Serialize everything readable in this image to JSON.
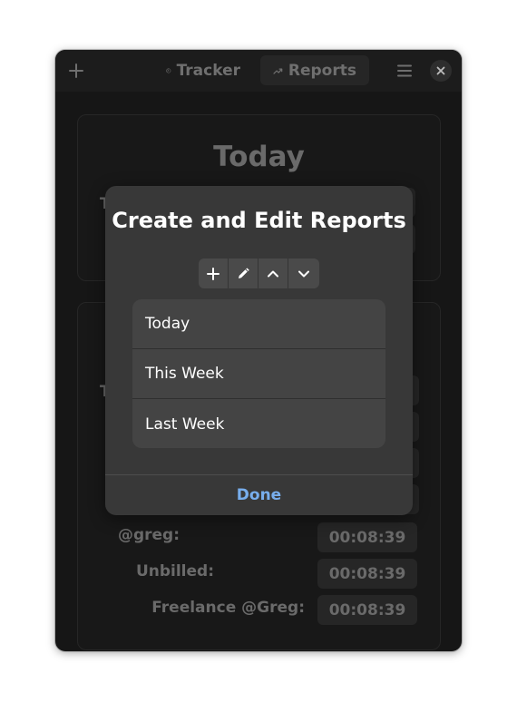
{
  "header": {
    "tabs": [
      {
        "label": "Tracker",
        "icon": "clock-icon"
      },
      {
        "label": "Reports",
        "icon": "trend-up-icon"
      }
    ],
    "active_tab": "Reports"
  },
  "background": {
    "card1_title": "Today",
    "fragment_t1": "T",
    "fragment_t2": "T",
    "rows": [
      {
        "label": "@greg:",
        "time": "00:08:39"
      },
      {
        "label": "Unbilled:",
        "time": "00:08:39"
      },
      {
        "label": "Freelance @Greg:",
        "time": "00:08:39"
      }
    ]
  },
  "dialog": {
    "title": "Create and Edit Reports",
    "toolbar_icons": [
      "plus-icon",
      "pencil-icon",
      "chevron-up-icon",
      "chevron-down-icon"
    ],
    "reports": [
      "Today",
      "This Week",
      "Last Week"
    ],
    "done_label": "Done"
  },
  "colors": {
    "accent": "#78aeed",
    "dialog_bg": "#383838",
    "window_bg": "#161616"
  }
}
